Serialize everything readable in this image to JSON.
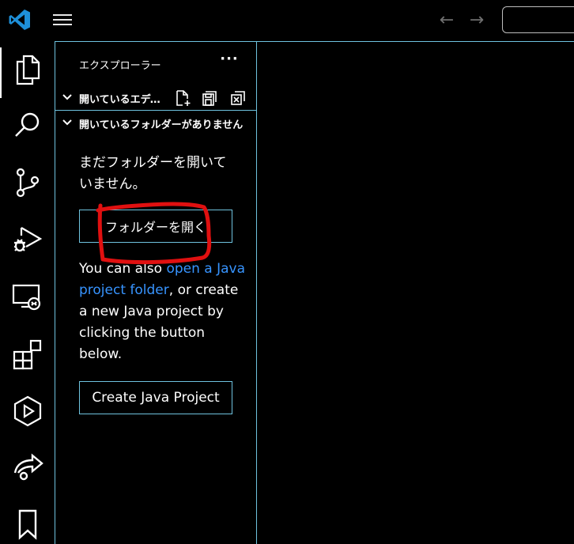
{
  "titlebar": {
    "nav_back_glyph": "←",
    "nav_forward_glyph": "→",
    "icons": [
      "vscode-logo-icon",
      "menu-icon",
      "arrow-left-icon",
      "arrow-right-icon"
    ]
  },
  "activity_bar": {
    "items": [
      {
        "name": "explorer",
        "icon": "files-icon",
        "active": true
      },
      {
        "name": "search",
        "icon": "search-icon"
      },
      {
        "name": "source-control",
        "icon": "source-control-icon"
      },
      {
        "name": "run-and-debug",
        "icon": "debug-icon"
      },
      {
        "name": "remote-explorer",
        "icon": "remote-explorer-icon"
      },
      {
        "name": "extensions",
        "icon": "extensions-icon"
      },
      {
        "name": "testing",
        "icon": "play-icon"
      },
      {
        "name": "live-share",
        "icon": "share-icon"
      },
      {
        "name": "bookmarks",
        "icon": "bookmark-icon"
      }
    ]
  },
  "sidebar": {
    "title": "エクスプローラー",
    "more_actions": "···",
    "open_editors": {
      "label": "開いているエディター",
      "actions": [
        "new-file-icon",
        "save-all-icon",
        "close-all-icon"
      ]
    },
    "folders": {
      "label": "開いているフォルダーがありません"
    },
    "welcome_text": "まだフォルダーを開いていません。",
    "open_folder_button": "フォルダーを開く",
    "hint": {
      "prefix": "You can also ",
      "link": "open a Java project folder",
      "suffix": ", or create a new Java project by clicking the button below."
    },
    "create_java_button": "Create Java Project"
  },
  "colors": {
    "background": "#000000",
    "border": "#6fc3df",
    "link": "#3794ff",
    "annotation": "#e01010"
  }
}
